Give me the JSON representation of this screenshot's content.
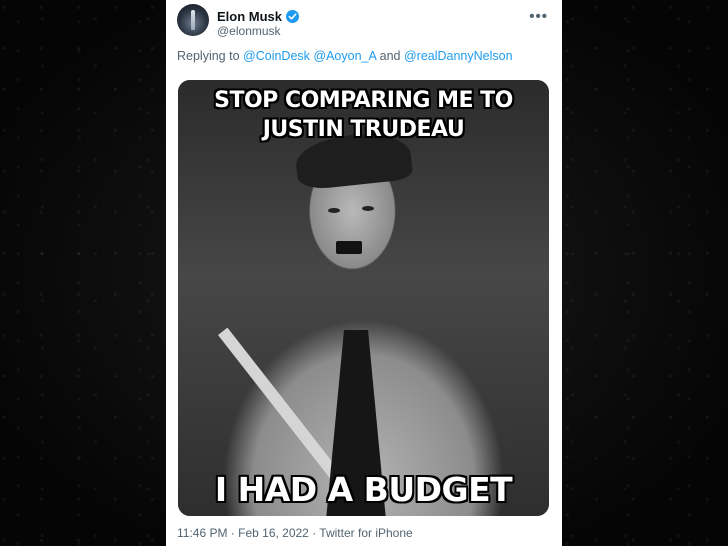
{
  "tweet": {
    "author": {
      "display_name": "Elon Musk",
      "handle": "@elonmusk",
      "verified_icon": "verified-badge-icon"
    },
    "more_icon": "more-horizontal-icon",
    "reply_prefix": "Replying to",
    "reply_mention_1": "@CoinDesk",
    "reply_mention_2": "@Aoyon_A",
    "reply_and": "and",
    "reply_mention_3": "@realDannyNelson",
    "media": {
      "top_text": "STOP COMPARING ME TO JUSTIN TRUDEAU",
      "bottom_text": "I HAD A BUDGET"
    },
    "timestamp": "11:46 PM · Feb 16, 2022 · Twitter for iPhone"
  },
  "colors": {
    "accent": "#1d9bf0",
    "text_primary": "#0f1419",
    "text_secondary": "#536471",
    "background": "#0b0b0b"
  }
}
